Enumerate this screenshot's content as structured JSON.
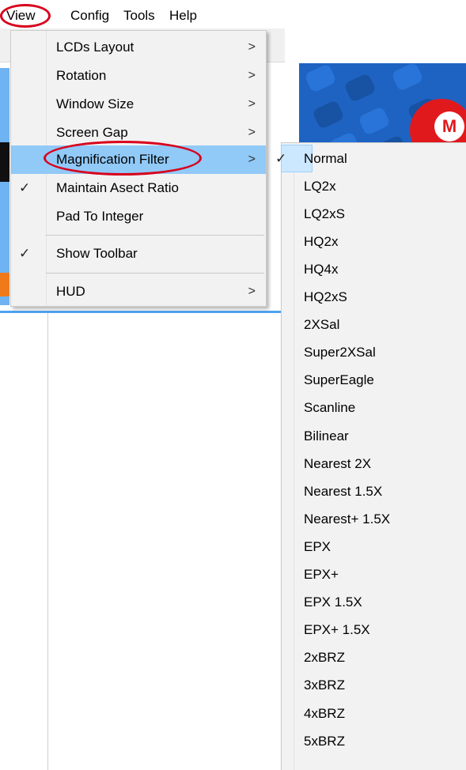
{
  "menubar": {
    "items": [
      {
        "label": "View"
      },
      {
        "label": "Config"
      },
      {
        "label": "Tools"
      },
      {
        "label": "Help"
      }
    ]
  },
  "view_menu": {
    "items": [
      {
        "label": "LCDs Layout",
        "submenu": true,
        "checked": false
      },
      {
        "label": "Rotation",
        "submenu": true,
        "checked": false
      },
      {
        "label": "Window Size",
        "submenu": true,
        "checked": false
      },
      {
        "label": "Screen Gap",
        "submenu": true,
        "checked": false
      },
      {
        "label": "Magnification Filter",
        "submenu": true,
        "checked": false,
        "highlighted": true
      },
      {
        "label": "Maintain Asect Ratio",
        "submenu": false,
        "checked": true
      },
      {
        "label": "Pad To Integer",
        "submenu": false,
        "checked": false
      },
      {
        "label": "Show Toolbar",
        "submenu": false,
        "checked": true
      },
      {
        "label": "HUD",
        "submenu": true,
        "checked": false
      }
    ]
  },
  "filter_submenu": {
    "items": [
      {
        "label": "Normal",
        "checked": true
      },
      {
        "label": "LQ2x"
      },
      {
        "label": "LQ2xS"
      },
      {
        "label": "HQ2x"
      },
      {
        "label": "HQ4x"
      },
      {
        "label": "HQ2xS"
      },
      {
        "label": "2XSal"
      },
      {
        "label": "Super2XSal"
      },
      {
        "label": "SuperEagle"
      },
      {
        "label": "Scanline"
      },
      {
        "label": "Bilinear"
      },
      {
        "label": "Nearest 2X"
      },
      {
        "label": "Nearest 1.5X"
      },
      {
        "label": "Nearest+ 1.5X"
      },
      {
        "label": "EPX"
      },
      {
        "label": "EPX+"
      },
      {
        "label": "EPX 1.5X"
      },
      {
        "label": "EPX+ 1.5X"
      },
      {
        "label": "2xBRZ"
      },
      {
        "label": "3xBRZ"
      },
      {
        "label": "4xBRZ"
      },
      {
        "label": "5xBRZ"
      }
    ]
  },
  "glyphs": {
    "check": "✓",
    "arrow": ">",
    "logo_letter": "M"
  },
  "colors": {
    "highlight": "#91c9f7",
    "annotation": "#d8001c",
    "menu_bg": "#f2f2f2"
  }
}
